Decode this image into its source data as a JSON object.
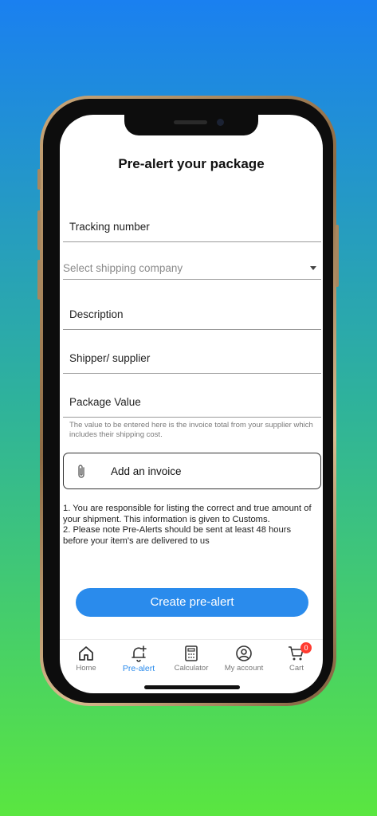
{
  "page": {
    "title": "Pre-alert your package"
  },
  "form": {
    "tracking_label": "Tracking number",
    "shipping_placeholder": "Select shipping company",
    "description_label": "Description",
    "shipper_label": "Shipper/ supplier",
    "value_label": "Package Value",
    "value_helper": "The value to be entered here is the invoice total from your supplier which includes their shipping cost.",
    "invoice_label": "Add an invoice"
  },
  "notes": [
    "1. You are responsible for listing the correct and true amount of your shipment. This information is given to Customs.",
    "2. Please note Pre-Alerts should be sent at least 48 hours before your item's are delivered to us"
  ],
  "actions": {
    "create_label": "Create pre-alert"
  },
  "tabbar": {
    "home": "Home",
    "prealert": "Pre-alert",
    "calculator": "Calculator",
    "account": "My account",
    "cart": "Cart",
    "cart_count": "0"
  },
  "icons": {
    "home": "home-icon",
    "prealert": "bell-plus-icon",
    "calculator": "calculator-icon",
    "account": "user-circle-icon",
    "cart": "cart-icon",
    "attach": "paperclip-icon"
  },
  "colors": {
    "accent": "#2a8bec",
    "badge": "#ff3b30",
    "gradient_top": "#1a80f0",
    "gradient_bottom": "#5ae640"
  }
}
